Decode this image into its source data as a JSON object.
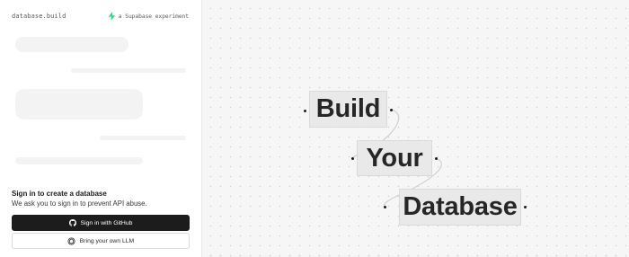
{
  "header": {
    "app_title": "database.build",
    "experiment_label": "a Supabase experiment",
    "brand_color": "#3ecf8e"
  },
  "signin": {
    "title": "Sign in to create a database",
    "subtitle": "We ask you to sign in to prevent API abuse.",
    "github_button_label": "Sign in with GitHub",
    "llm_button_label": "Bring your own LLM"
  },
  "canvas": {
    "words": [
      "Build",
      "Your",
      "Database"
    ]
  },
  "icons": {
    "experiment": "lightning-bolt-icon",
    "github": "github-icon",
    "llm": "openai-icon"
  }
}
